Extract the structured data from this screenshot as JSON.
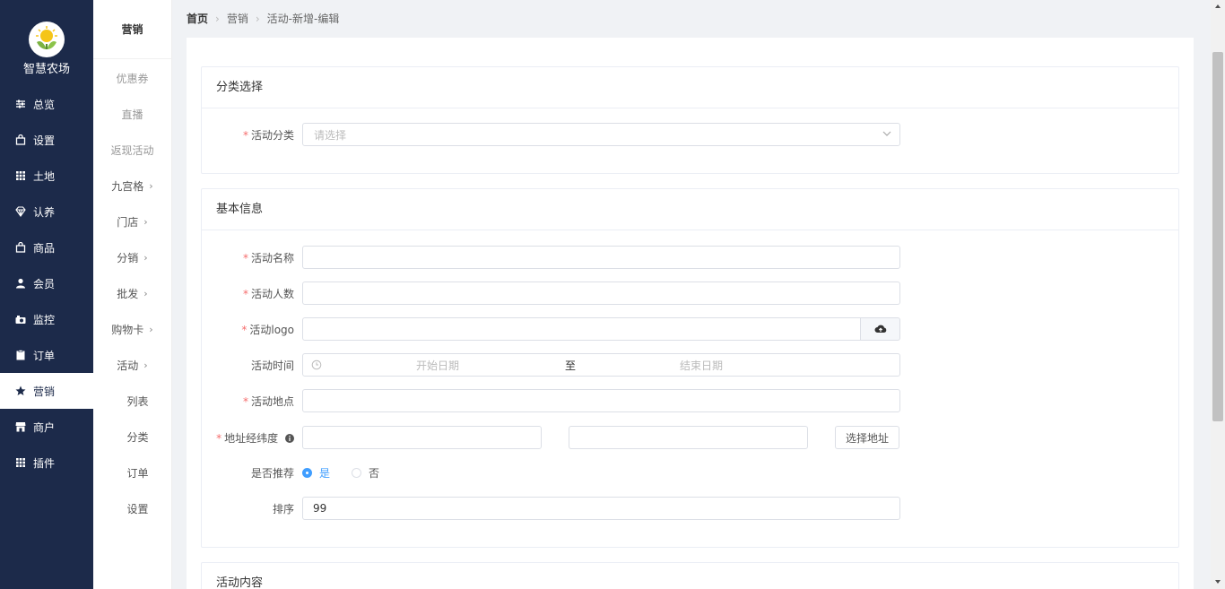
{
  "app": {
    "name": "智慧农场"
  },
  "nav": [
    {
      "label": "总览",
      "icon": "sliders-icon"
    },
    {
      "label": "设置",
      "icon": "bag-icon"
    },
    {
      "label": "土地",
      "icon": "grid-icon"
    },
    {
      "label": "认养",
      "icon": "gem-icon"
    },
    {
      "label": "商品",
      "icon": "bag-icon"
    },
    {
      "label": "会员",
      "icon": "user-icon"
    },
    {
      "label": "监控",
      "icon": "camera-icon"
    },
    {
      "label": "订单",
      "icon": "clipboard-icon"
    },
    {
      "label": "营销",
      "icon": "star-icon"
    },
    {
      "label": "商户",
      "icon": "store-icon"
    },
    {
      "label": "插件",
      "icon": "grid-icon"
    }
  ],
  "subnav": {
    "title": "营销",
    "items": [
      {
        "label": "优惠券"
      },
      {
        "label": "直播"
      },
      {
        "label": "返现活动"
      },
      {
        "label": "九宫格"
      },
      {
        "label": "门店"
      },
      {
        "label": "分销"
      },
      {
        "label": "批发"
      },
      {
        "label": "购物卡"
      },
      {
        "label": "活动"
      },
      {
        "label": "列表"
      },
      {
        "label": "分类"
      },
      {
        "label": "订单"
      },
      {
        "label": "设置"
      }
    ]
  },
  "breadcrumb": {
    "home": "首页",
    "level1": "营销",
    "level2": "活动-新增-编辑"
  },
  "sections": {
    "category": {
      "title": "分类选择",
      "field_label": "活动分类",
      "placeholder": "请选择"
    },
    "basic": {
      "title": "基本信息",
      "name_label": "活动名称",
      "count_label": "活动人数",
      "logo_label": "活动logo",
      "time_label": "活动时间",
      "start_placeholder": "开始日期",
      "range_sep": "至",
      "end_placeholder": "结束日期",
      "place_label": "活动地点",
      "coords_label": "地址经纬度",
      "choose_address": "选择地址",
      "recommend_label": "是否推荐",
      "yes": "是",
      "no": "否",
      "sort_label": "排序",
      "sort_value": "99"
    },
    "content": {
      "title": "活动内容"
    }
  },
  "colors": {
    "sidebar": "#1c2a4a",
    "accent": "#409eff",
    "required": "#f56c6c"
  }
}
